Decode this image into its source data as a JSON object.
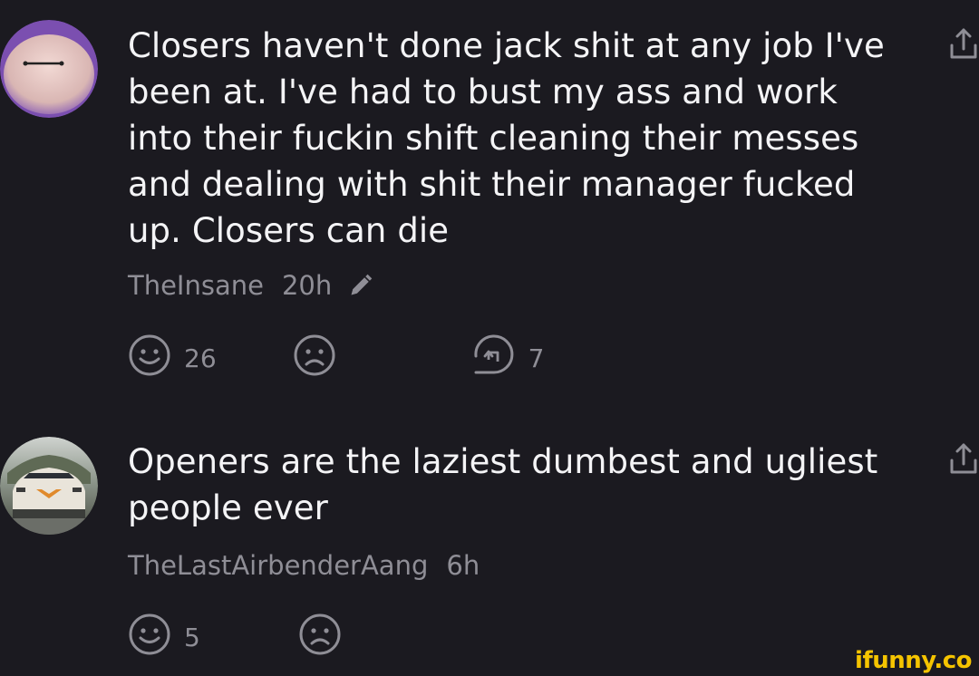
{
  "comments": [
    {
      "text": "Closers haven't done jack shit at any job I've been at. I've had to bust my ass and work into their fuckin shift cleaning their messes and dealing with shit their manager fucked up. Closers can die",
      "username": "TheInsane",
      "time": "20h",
      "edited": true,
      "likes": "26",
      "replies": "7",
      "avatar": "smiling-round-face"
    },
    {
      "text": "Openers are the laziest dumbest and ugliest people ever",
      "username": "TheLastAirbenderAang",
      "time": "6h",
      "edited": false,
      "likes": "5",
      "avatar": "car-with-arrow"
    }
  ],
  "watermark": "ifunny.co",
  "colors": {
    "background": "#1b1a20",
    "text": "#f4f4f6",
    "muted": "#8f8e96",
    "watermark": "#f5c400"
  },
  "icons": [
    "share-icon",
    "smile-icon",
    "frown-icon",
    "reply-icon",
    "pencil-icon"
  ]
}
